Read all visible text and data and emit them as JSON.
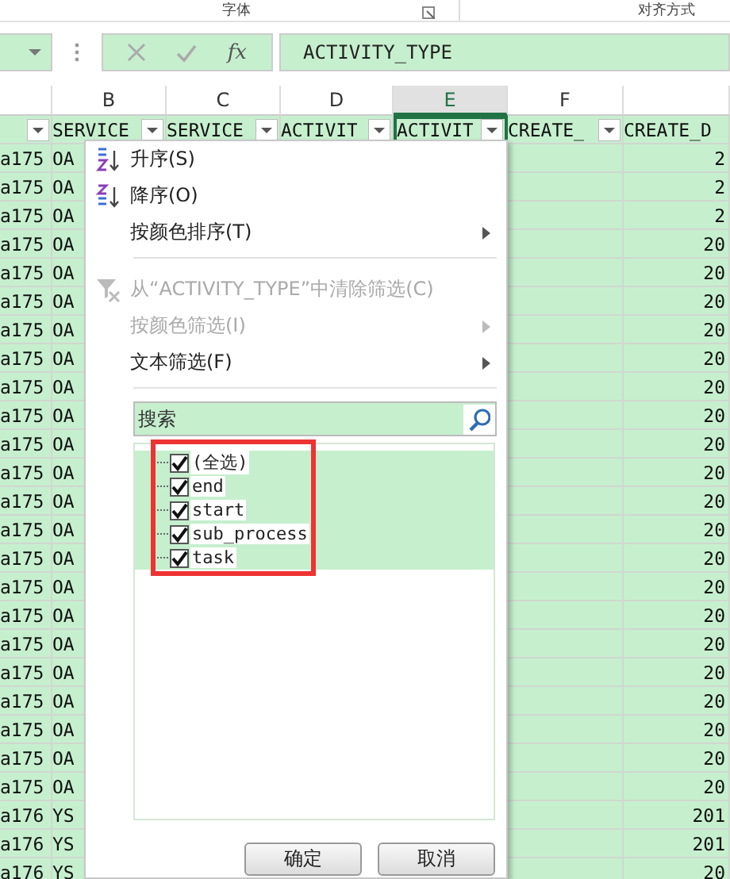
{
  "ribbon": {
    "groups": [
      {
        "label": "字体"
      },
      {
        "label": "对齐方式"
      }
    ]
  },
  "formula_bar": {
    "fx": "fx",
    "formula": "ACTIVITY_TYPE"
  },
  "columns": [
    {
      "header_filter": true,
      "selected": false
    },
    {
      "letter": "B",
      "header": "SERVICE",
      "header_filter": true,
      "selected": false
    },
    {
      "letter": "C",
      "header": "SERVICE",
      "header_filter": true,
      "selected": false
    },
    {
      "letter": "D",
      "header": "ACTIVIT",
      "header_filter": true,
      "selected": false
    },
    {
      "letter": "E",
      "header": "ACTIVIT",
      "header_filter": true,
      "selected": true
    },
    {
      "letter": "F",
      "header": "CREATE_",
      "header_filter": true,
      "selected": false
    },
    {
      "header": "CREATE_D",
      "header_filter": false,
      "selected": false
    }
  ],
  "rows": [
    {
      "col_a": "a175",
      "col_b": "OA",
      "col_g": "2"
    },
    {
      "col_a": "a175",
      "col_b": "OA",
      "col_g": "2"
    },
    {
      "col_a": "a175",
      "col_b": "OA",
      "col_g": "2"
    },
    {
      "col_a": "a175",
      "col_b": "OA",
      "col_g": "20"
    },
    {
      "col_a": "a175",
      "col_b": "OA",
      "col_g": "20"
    },
    {
      "col_a": "a175",
      "col_b": "OA",
      "col_g": "20"
    },
    {
      "col_a": "a175",
      "col_b": "OA",
      "col_g": "20"
    },
    {
      "col_a": "a175",
      "col_b": "OA",
      "col_g": "20"
    },
    {
      "col_a": "a175",
      "col_b": "OA",
      "col_g": "20"
    },
    {
      "col_a": "a175",
      "col_b": "OA",
      "col_g": "20"
    },
    {
      "col_a": "a175",
      "col_b": "OA",
      "col_g": "20"
    },
    {
      "col_a": "a175",
      "col_b": "OA",
      "col_g": "20"
    },
    {
      "col_a": "a175",
      "col_b": "OA",
      "col_g": "20"
    },
    {
      "col_a": "a175",
      "col_b": "OA",
      "col_g": "20"
    },
    {
      "col_a": "a175",
      "col_b": "OA",
      "col_g": "20"
    },
    {
      "col_a": "a175",
      "col_b": "OA",
      "col_g": "20"
    },
    {
      "col_a": "a175",
      "col_b": "OA",
      "col_g": "20"
    },
    {
      "col_a": "a175",
      "col_b": "OA",
      "col_g": "20"
    },
    {
      "col_a": "a175",
      "col_b": "OA",
      "col_g": "20"
    },
    {
      "col_a": "a175",
      "col_b": "OA",
      "col_g": "20"
    },
    {
      "col_a": "a175",
      "col_b": "OA",
      "col_g": "20"
    },
    {
      "col_a": "a175",
      "col_b": "OA",
      "col_g": "20"
    },
    {
      "col_a": "a175",
      "col_b": "OA",
      "col_g": "20"
    },
    {
      "col_a": "a176",
      "col_b": "YS",
      "col_g": "201"
    },
    {
      "col_a": "a176",
      "col_b": "YS",
      "col_g": "201"
    },
    {
      "col_a": "a176",
      "col_b": "YS",
      "col_g": "20"
    }
  ],
  "filter_menu": {
    "items": [
      {
        "kind": "sort_asc",
        "label": "升序(S)",
        "disabled": false,
        "submenu": false
      },
      {
        "kind": "sort_desc",
        "label": "降序(O)",
        "disabled": false,
        "submenu": false
      },
      {
        "kind": "plain",
        "label": "按颜色排序(T)",
        "disabled": false,
        "submenu": true
      },
      {
        "kind": "separator"
      },
      {
        "kind": "clear_filter",
        "label": "从“ACTIVITY_TYPE”中清除筛选(C)",
        "disabled": true,
        "submenu": false
      },
      {
        "kind": "plain",
        "label": "按颜色筛选(I)",
        "disabled": true,
        "submenu": true
      },
      {
        "kind": "plain",
        "label": "文本筛选(F)",
        "disabled": false,
        "submenu": true
      },
      {
        "kind": "separator"
      }
    ],
    "search": {
      "placeholder": "搜索"
    },
    "values": [
      {
        "label": "(全选)",
        "checked": true
      },
      {
        "label": "end",
        "checked": true
      },
      {
        "label": "start",
        "checked": true
      },
      {
        "label": "sub_process",
        "checked": true
      },
      {
        "label": "task",
        "checked": true
      }
    ],
    "buttons": [
      {
        "label": "确定"
      },
      {
        "label": "取消"
      }
    ]
  },
  "annotation": {
    "color": "#ee3333"
  }
}
